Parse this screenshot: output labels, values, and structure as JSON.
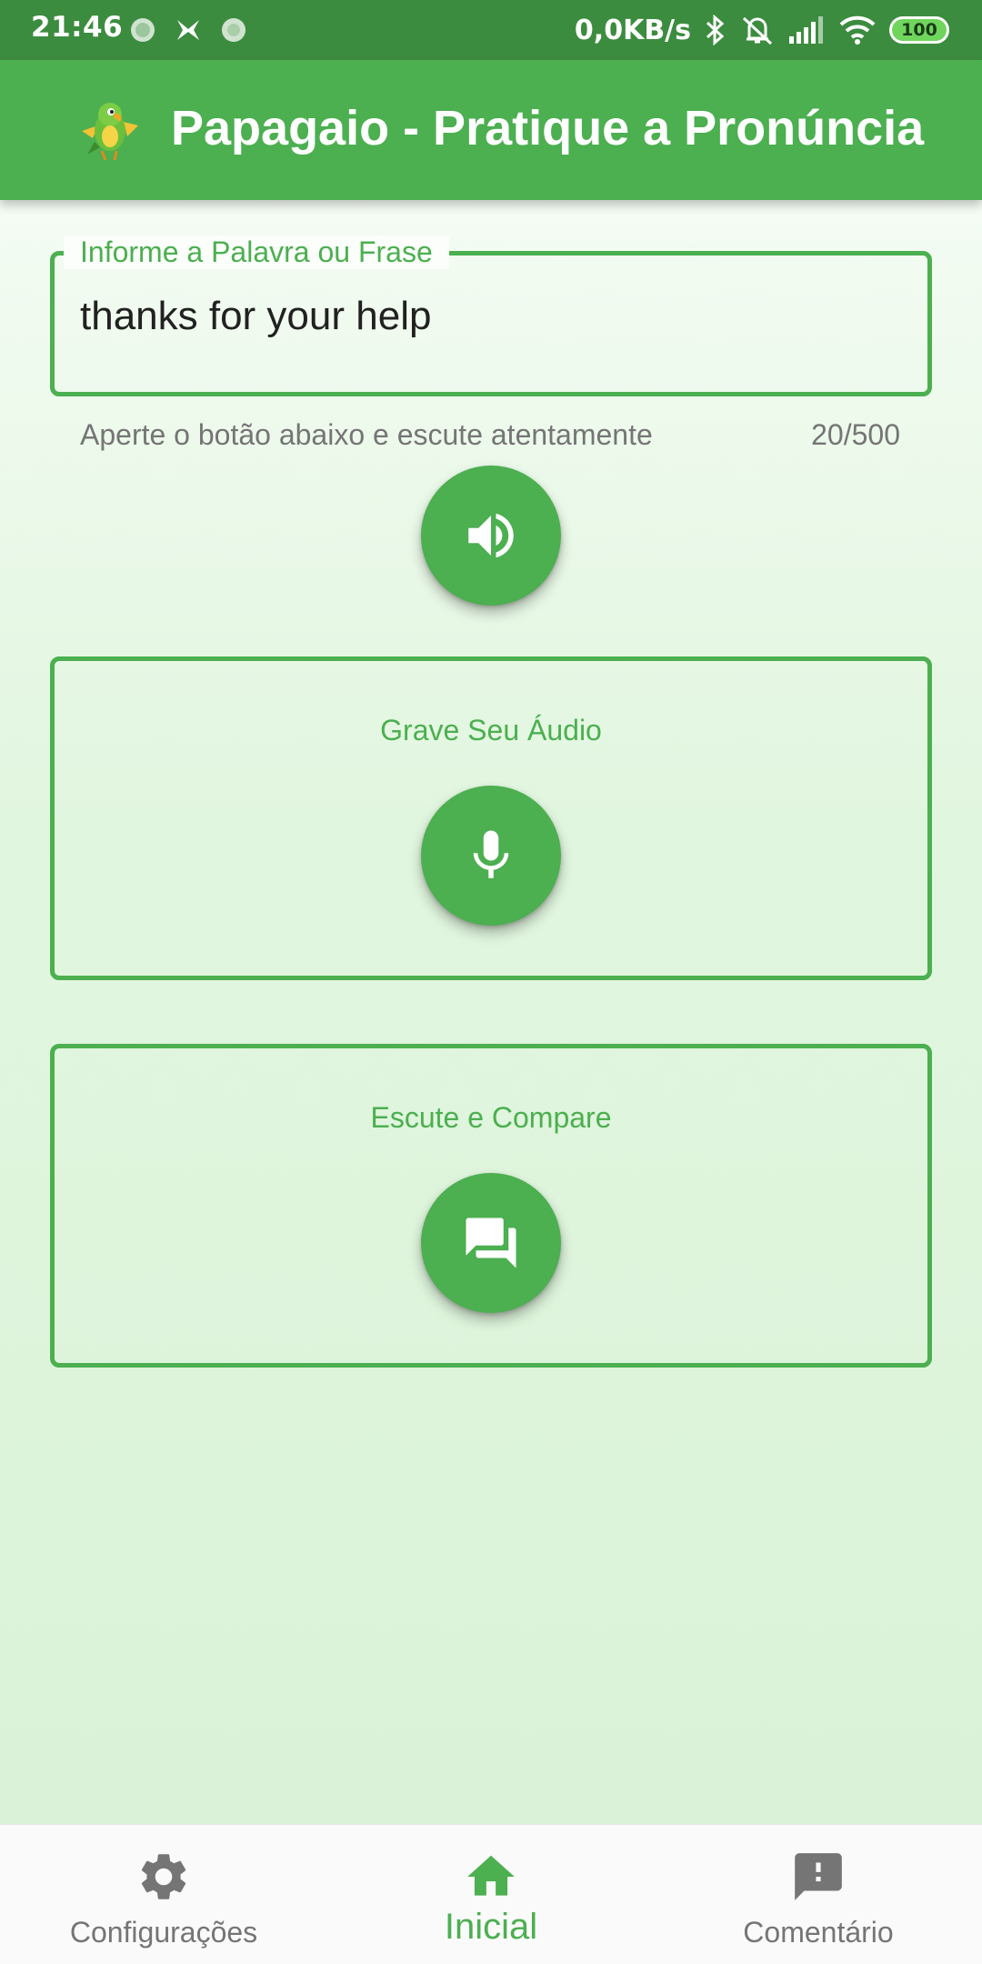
{
  "status_bar": {
    "time": "21:46",
    "network_speed": "0,0KB/s",
    "battery": "100",
    "icons": [
      "notification-icon",
      "notification-icon",
      "notification-icon",
      "bluetooth-icon",
      "alarm-off-icon",
      "signal-icon",
      "wifi-icon",
      "battery-icon"
    ]
  },
  "app_bar": {
    "title": "Papagaio - Pratique a Pronúncia",
    "logo": "parrot-logo"
  },
  "input": {
    "label": "Informe a Palavra ou Frase",
    "value": "thanks for your help",
    "helper": "Aperte o botão abaixo e escute atentamente",
    "counter": "20/500"
  },
  "buttons": {
    "listen_icon": "volume-up-icon",
    "record_icon": "microphone-icon",
    "compare_icon": "forum-icon"
  },
  "cards": {
    "record_title": "Grave Seu Áudio",
    "compare_title": "Escute e Compare"
  },
  "bottom_nav": {
    "items": [
      {
        "label": "Configurações",
        "icon": "gear-icon",
        "active": false
      },
      {
        "label": "Inicial",
        "icon": "home-icon",
        "active": true
      },
      {
        "label": "Comentário",
        "icon": "feedback-icon",
        "active": false
      }
    ]
  },
  "colors": {
    "primary": "#4caf50",
    "status_bar": "#3c8c3f",
    "text_secondary": "#757575"
  }
}
